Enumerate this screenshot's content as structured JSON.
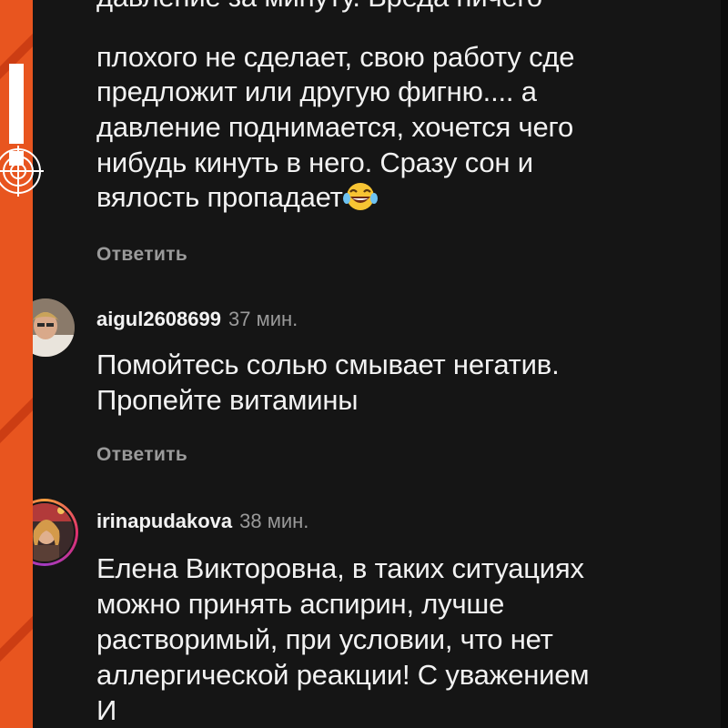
{
  "comments": [
    {
      "id": "top-partial",
      "lines": [
        "давление за минуту. Вреда ничего",
        "плохого не сделает, свою работу сде",
        "предложит или другую фигню.... а",
        "давление поднимается, хочется чего",
        "нибудь кинуть в него. Сразу сон и",
        "вялость пропадает"
      ],
      "reply_label": "Ответить"
    },
    {
      "id": "aigul",
      "username": "aigul2608699",
      "time": "37 мин.",
      "lines": [
        "Помойтесь солью  смывает негатив.",
        "Пропейте витамины"
      ],
      "reply_label": "Ответить"
    },
    {
      "id": "irina",
      "username": "irinapudakova",
      "time": "38 мин.",
      "lines": [
        "Елена Викторовна, в таких ситуациях",
        "можно принять аспирин, лучше",
        "растворимый,  при условии, что нет",
        "аллергической реакции! С уважением",
        "И"
      ]
    }
  ],
  "icons": {
    "emoji": "laughing-with-tears-emoji",
    "alert": "exclamation-icon",
    "target": "target-icon"
  },
  "colors": {
    "background_frame": "#e8551f",
    "screen": "#151515",
    "text": "#f2f2f2",
    "muted": "#9a9a9a"
  }
}
